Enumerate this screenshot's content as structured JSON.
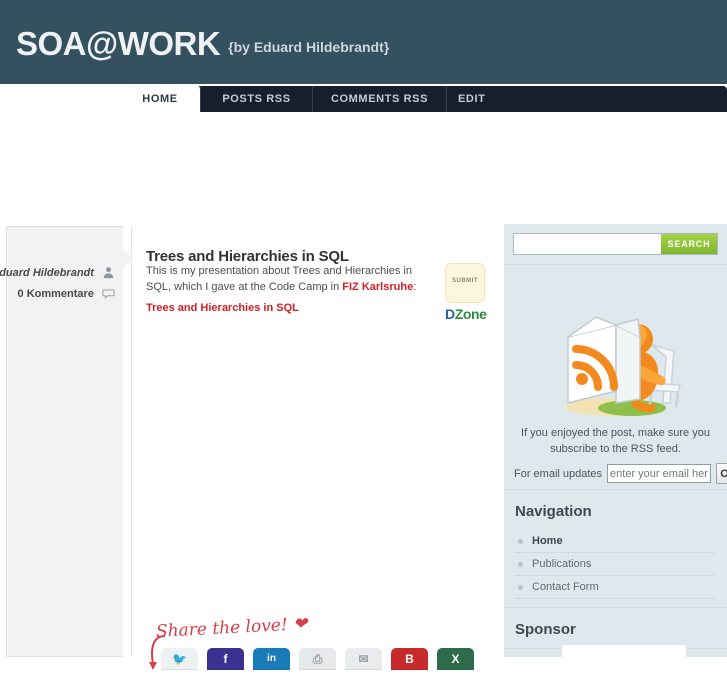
{
  "header": {
    "site_title": "SOA@WORK",
    "tagline": "{by Eduard Hildebrandt}",
    "brand_color": "#35505f"
  },
  "nav": {
    "tabs": [
      {
        "label": "HOME",
        "active": true
      },
      {
        "label": "POSTS RSS",
        "active": false
      },
      {
        "label": "COMMENTS RSS",
        "active": false
      },
      {
        "label": "EDIT",
        "active": false
      }
    ],
    "bar_color": "#16202b"
  },
  "post_meta": {
    "author": "Eduard Hildebrandt",
    "comments": "0 Kommentare"
  },
  "post": {
    "title": "Trees and Hierarchies in SQL",
    "body_part1": "This is my presentation about Trees and Hierarchies in SQL, which I gave at the Code Camp in ",
    "body_highlight": "FIZ Karlsruhe",
    "body_part2": ":",
    "link_text": "Trees and Hierarchies in SQL",
    "link_color": "#d21f26"
  },
  "dzone": {
    "submit_label": "SUBMIT",
    "brand_d": "D",
    "brand_zone": "Zone"
  },
  "share": {
    "caption": "Share the love!",
    "icons": [
      {
        "name": "twitter-share-icon",
        "label": "Twitter",
        "color": "#eef1f3",
        "glyph": "🐦"
      },
      {
        "name": "facebook-share-icon",
        "label": "Facebook",
        "color": "#3b3090",
        "glyph": "f"
      },
      {
        "name": "linkedin-share-icon",
        "label": "LinkedIn",
        "color": "#1a7bb9",
        "glyph": "in"
      },
      {
        "name": "printer-share-icon",
        "label": "Print",
        "color": "#e6e8ea",
        "glyph": "⎙"
      },
      {
        "name": "email-share-icon",
        "label": "Email",
        "color": "#e9ebec",
        "glyph": "✉"
      },
      {
        "name": "blogger-share-icon",
        "label": "Blogger",
        "color": "#c62a2a",
        "glyph": "B"
      },
      {
        "name": "xing-share-icon",
        "label": "Xing",
        "color": "#2e6b4a",
        "glyph": "X"
      }
    ]
  },
  "search": {
    "value": "",
    "placeholder": "",
    "button_label": "SEARCH",
    "button_color": "#8cc63f"
  },
  "rss": {
    "text": "If you enjoyed the post, make sure you subscribe to the RSS feed.",
    "email_label": "For email updates",
    "email_placeholder": "enter your email here",
    "email_value": "",
    "ok_label": "OK"
  },
  "navigation": {
    "heading": "Navigation",
    "items": [
      {
        "label": "Home",
        "current": true
      },
      {
        "label": "Publications",
        "current": false
      },
      {
        "label": "Contact Form",
        "current": false
      }
    ]
  },
  "sponsor": {
    "heading": "Sponsor"
  }
}
